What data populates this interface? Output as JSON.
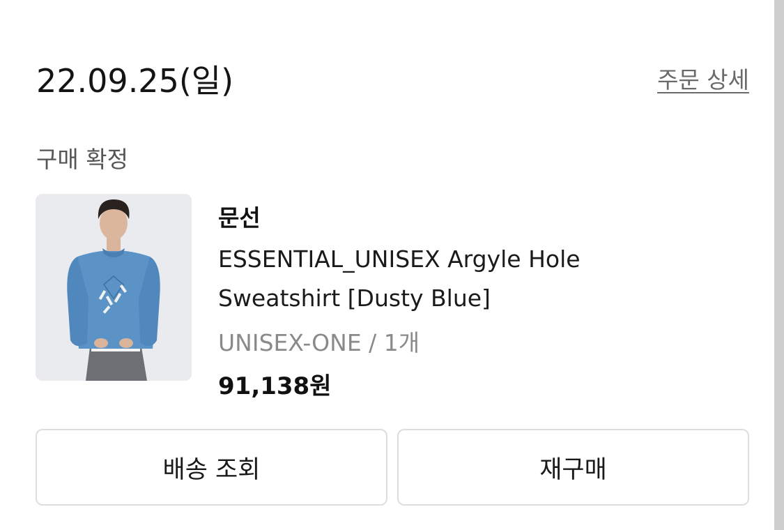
{
  "order": {
    "date": "22.09.25(일)",
    "detail_link": "주문 상세",
    "status": "구매 확정"
  },
  "product": {
    "image_icon": "product-photo-sweatshirt",
    "brand": "문선",
    "name": "ESSENTIAL_UNISEX Argyle Hole Sweatshirt [Dusty Blue]",
    "option": "UNISEX-ONE / 1개",
    "price": "91,138원"
  },
  "actions": {
    "delivery_label": "배송 조회",
    "rebuy_label": "재구매"
  },
  "colors": {
    "text_primary": "#111111",
    "text_secondary": "#8a8a8a",
    "button_border": "#dedede",
    "sweatshirt": "#5b93c7"
  }
}
